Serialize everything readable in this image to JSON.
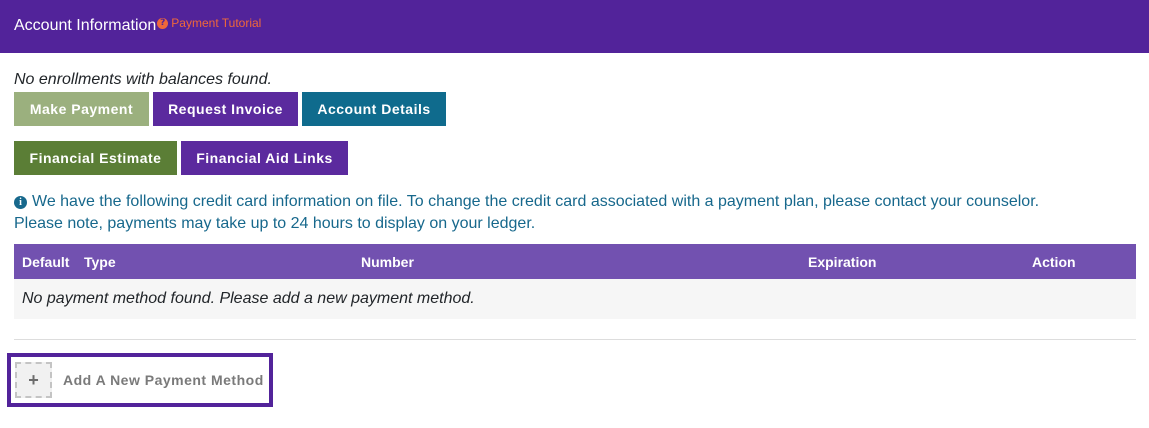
{
  "header": {
    "title": "Account Information",
    "tutorial_icon": "question-circle-icon",
    "tutorial_label": "Payment Tutorial"
  },
  "notice": "No enrollments with balances found.",
  "buttons": {
    "make_payment": "Make Payment",
    "request_invoice": "Request Invoice",
    "account_details": "Account Details",
    "financial_estimate": "Financial Estimate",
    "financial_aid_links": "Financial Aid Links"
  },
  "info": {
    "icon": "info-circle-icon",
    "line1": "We have the following credit card information on file. To change the credit card associated with a payment plan, please contact your counselor.",
    "line2": "Please note, payments may take up to 24 hours to display on your ledger."
  },
  "table": {
    "columns": [
      "Default",
      "Type",
      "Number",
      "Expiration",
      "Action"
    ],
    "empty_message": "No payment method found. Please add a new payment method."
  },
  "add_method": {
    "icon": "plus-icon",
    "label": "Add A New Payment Method"
  },
  "colors": {
    "header_bg": "#52239a",
    "tutorial": "#f0683a",
    "make_payment": "#9bb07e",
    "request_invoice": "#5b2a9e",
    "account_details": "#0f6b8d",
    "financial_estimate": "#5b7e36",
    "financial_aid_links": "#5b2a9e",
    "info_text": "#17688c",
    "table_header": "#7251b0"
  }
}
